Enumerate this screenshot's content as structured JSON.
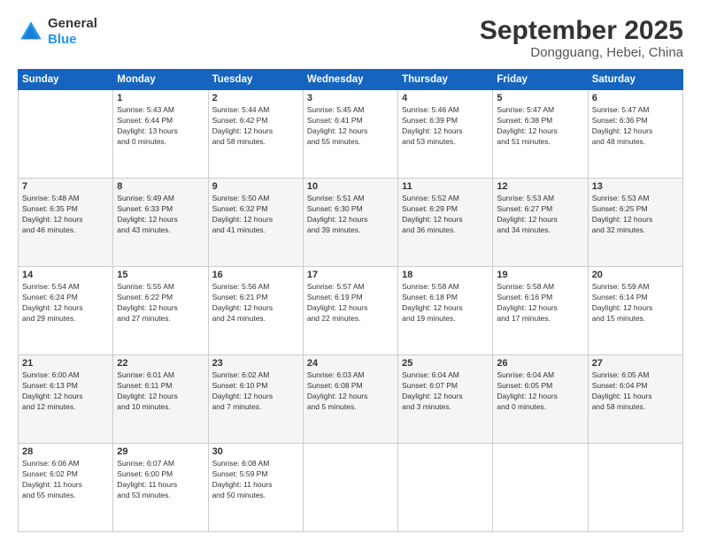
{
  "header": {
    "logo": {
      "general": "General",
      "blue": "Blue"
    },
    "month": "September 2025",
    "location": "Dongguang, Hebei, China"
  },
  "weekdays": [
    "Sunday",
    "Monday",
    "Tuesday",
    "Wednesday",
    "Thursday",
    "Friday",
    "Saturday"
  ],
  "weeks": [
    [
      {
        "day": "",
        "info": ""
      },
      {
        "day": "1",
        "info": "Sunrise: 5:43 AM\nSunset: 6:44 PM\nDaylight: 13 hours\nand 0 minutes."
      },
      {
        "day": "2",
        "info": "Sunrise: 5:44 AM\nSunset: 6:42 PM\nDaylight: 12 hours\nand 58 minutes."
      },
      {
        "day": "3",
        "info": "Sunrise: 5:45 AM\nSunset: 6:41 PM\nDaylight: 12 hours\nand 55 minutes."
      },
      {
        "day": "4",
        "info": "Sunrise: 5:46 AM\nSunset: 6:39 PM\nDaylight: 12 hours\nand 53 minutes."
      },
      {
        "day": "5",
        "info": "Sunrise: 5:47 AM\nSunset: 6:38 PM\nDaylight: 12 hours\nand 51 minutes."
      },
      {
        "day": "6",
        "info": "Sunrise: 5:47 AM\nSunset: 6:36 PM\nDaylight: 12 hours\nand 48 minutes."
      }
    ],
    [
      {
        "day": "7",
        "info": "Sunrise: 5:48 AM\nSunset: 6:35 PM\nDaylight: 12 hours\nand 46 minutes."
      },
      {
        "day": "8",
        "info": "Sunrise: 5:49 AM\nSunset: 6:33 PM\nDaylight: 12 hours\nand 43 minutes."
      },
      {
        "day": "9",
        "info": "Sunrise: 5:50 AM\nSunset: 6:32 PM\nDaylight: 12 hours\nand 41 minutes."
      },
      {
        "day": "10",
        "info": "Sunrise: 5:51 AM\nSunset: 6:30 PM\nDaylight: 12 hours\nand 39 minutes."
      },
      {
        "day": "11",
        "info": "Sunrise: 5:52 AM\nSunset: 6:29 PM\nDaylight: 12 hours\nand 36 minutes."
      },
      {
        "day": "12",
        "info": "Sunrise: 5:53 AM\nSunset: 6:27 PM\nDaylight: 12 hours\nand 34 minutes."
      },
      {
        "day": "13",
        "info": "Sunrise: 5:53 AM\nSunset: 6:25 PM\nDaylight: 12 hours\nand 32 minutes."
      }
    ],
    [
      {
        "day": "14",
        "info": "Sunrise: 5:54 AM\nSunset: 6:24 PM\nDaylight: 12 hours\nand 29 minutes."
      },
      {
        "day": "15",
        "info": "Sunrise: 5:55 AM\nSunset: 6:22 PM\nDaylight: 12 hours\nand 27 minutes."
      },
      {
        "day": "16",
        "info": "Sunrise: 5:56 AM\nSunset: 6:21 PM\nDaylight: 12 hours\nand 24 minutes."
      },
      {
        "day": "17",
        "info": "Sunrise: 5:57 AM\nSunset: 6:19 PM\nDaylight: 12 hours\nand 22 minutes."
      },
      {
        "day": "18",
        "info": "Sunrise: 5:58 AM\nSunset: 6:18 PM\nDaylight: 12 hours\nand 19 minutes."
      },
      {
        "day": "19",
        "info": "Sunrise: 5:58 AM\nSunset: 6:16 PM\nDaylight: 12 hours\nand 17 minutes."
      },
      {
        "day": "20",
        "info": "Sunrise: 5:59 AM\nSunset: 6:14 PM\nDaylight: 12 hours\nand 15 minutes."
      }
    ],
    [
      {
        "day": "21",
        "info": "Sunrise: 6:00 AM\nSunset: 6:13 PM\nDaylight: 12 hours\nand 12 minutes."
      },
      {
        "day": "22",
        "info": "Sunrise: 6:01 AM\nSunset: 6:11 PM\nDaylight: 12 hours\nand 10 minutes."
      },
      {
        "day": "23",
        "info": "Sunrise: 6:02 AM\nSunset: 6:10 PM\nDaylight: 12 hours\nand 7 minutes."
      },
      {
        "day": "24",
        "info": "Sunrise: 6:03 AM\nSunset: 6:08 PM\nDaylight: 12 hours\nand 5 minutes."
      },
      {
        "day": "25",
        "info": "Sunrise: 6:04 AM\nSunset: 6:07 PM\nDaylight: 12 hours\nand 3 minutes."
      },
      {
        "day": "26",
        "info": "Sunrise: 6:04 AM\nSunset: 6:05 PM\nDaylight: 12 hours\nand 0 minutes."
      },
      {
        "day": "27",
        "info": "Sunrise: 6:05 AM\nSunset: 6:04 PM\nDaylight: 11 hours\nand 58 minutes."
      }
    ],
    [
      {
        "day": "28",
        "info": "Sunrise: 6:06 AM\nSunset: 6:02 PM\nDaylight: 11 hours\nand 55 minutes."
      },
      {
        "day": "29",
        "info": "Sunrise: 6:07 AM\nSunset: 6:00 PM\nDaylight: 11 hours\nand 53 minutes."
      },
      {
        "day": "30",
        "info": "Sunrise: 6:08 AM\nSunset: 5:59 PM\nDaylight: 11 hours\nand 50 minutes."
      },
      {
        "day": "",
        "info": ""
      },
      {
        "day": "",
        "info": ""
      },
      {
        "day": "",
        "info": ""
      },
      {
        "day": "",
        "info": ""
      }
    ]
  ]
}
